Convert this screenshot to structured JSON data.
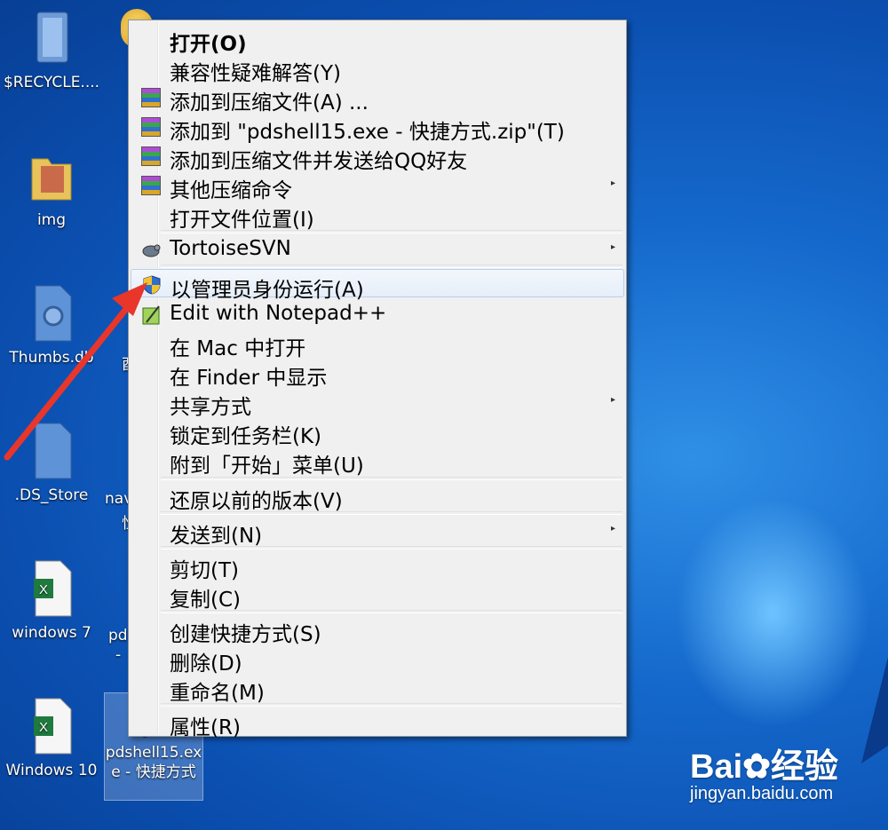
{
  "desktop": {
    "icons": [
      {
        "label": "$RECYCLE...."
      },
      {
        "label": "img"
      },
      {
        "label": "Thumbs.db"
      },
      {
        "label": ".DS_Store"
      },
      {
        "label": "windows 7"
      },
      {
        "label": "Windows 10"
      },
      {
        "label": "pdshell15.exe - 快捷方式"
      }
    ],
    "partial_labels": [
      "酉",
      "nav",
      "性",
      "pd",
      "-"
    ]
  },
  "context_menu": {
    "items": [
      {
        "label": "打开(O)",
        "bold": true
      },
      {
        "label": "兼容性疑难解答(Y)"
      },
      {
        "label": "添加到压缩文件(A) ...",
        "icon": "rar-icon"
      },
      {
        "label": "添加到 \"pdshell15.exe - 快捷方式.zip\"(T)",
        "icon": "rar-icon"
      },
      {
        "label": "添加到压缩文件并发送给QQ好友",
        "icon": "rar-icon"
      },
      {
        "label": "其他压缩命令",
        "icon": "rar-icon",
        "submenu": true
      },
      {
        "label": "打开文件位置(I)"
      },
      {
        "label": "TortoiseSVN",
        "icon": "tortoise-icon",
        "submenu": true
      },
      {
        "label": "以管理员身份运行(A)",
        "icon": "uac-shield-icon",
        "highlighted": true
      },
      {
        "label": "Edit with Notepad++",
        "icon": "notepad-plus-icon"
      },
      {
        "label": "在 Mac 中打开"
      },
      {
        "label": "在 Finder 中显示"
      },
      {
        "label": "共享方式",
        "submenu": true
      },
      {
        "label": "锁定到任务栏(K)"
      },
      {
        "label": "附到「开始」菜单(U)"
      },
      {
        "label": "还原以前的版本(V)"
      },
      {
        "label": "发送到(N)",
        "submenu": true
      },
      {
        "label": "剪切(T)"
      },
      {
        "label": "复制(C)"
      },
      {
        "label": "创建快捷方式(S)"
      },
      {
        "label": "删除(D)"
      },
      {
        "label": "重命名(M)"
      },
      {
        "label": "属性(R)"
      }
    ],
    "submenu_arrow": "▸"
  },
  "watermark": {
    "brand": "Bai",
    "brand2": "经验",
    "url": "jingyan.baidu.com"
  },
  "colors": {
    "desktop": "#1569cc",
    "menu_bg": "#f0f0f0",
    "annotation_arrow": "#e8362b"
  }
}
